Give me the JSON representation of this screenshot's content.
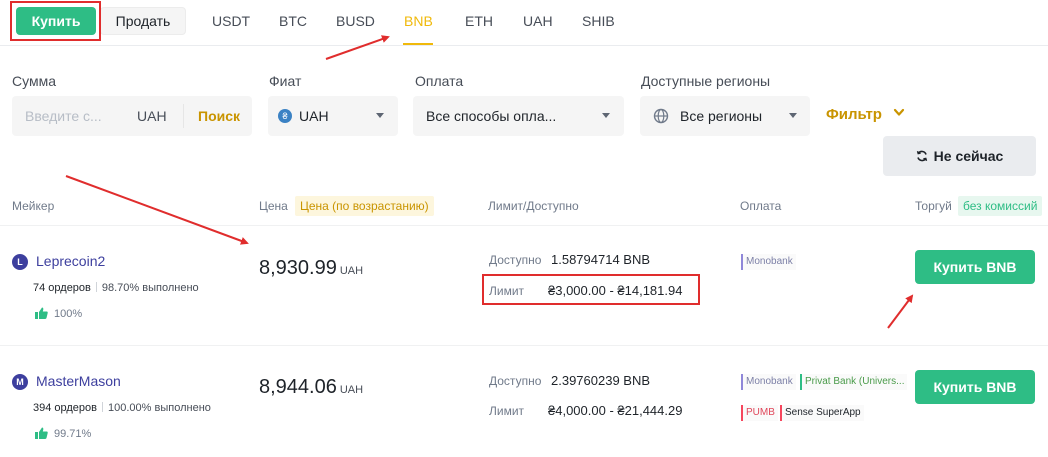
{
  "trade_toggle": {
    "buy": "Купить",
    "sell": "Продать"
  },
  "coins": [
    "USDT",
    "BTC",
    "BUSD",
    "BNB",
    "ETH",
    "UAH",
    "SHIB"
  ],
  "active_coin": "BNB",
  "filters": {
    "amount_label": "Сумма",
    "amount_placeholder": "Введите с...",
    "amount_currency": "UAH",
    "search": "Поиск",
    "fiat_label": "Фиат",
    "fiat_value": "UAH",
    "payment_label": "Оплата",
    "payment_value": "Все способы опла...",
    "regions_label": "Доступные регионы",
    "regions_value": "Все регионы",
    "filter": "Фильтр",
    "not_now": "Не сейчас"
  },
  "table_header": {
    "maker": "Мейкер",
    "price": "Цена",
    "price_badge": "Цена (по возрастанию)",
    "limit": "Лимит/Доступно",
    "payment": "Оплата",
    "trade": "Торгуй",
    "trade_badge": "без комиссий"
  },
  "rows": [
    {
      "avatar": "L",
      "maker": "Leprecoin2",
      "orders": "74 ордеров",
      "completion": "98.70% выполнено",
      "rating": "100%",
      "price": "8,930.99",
      "currency": "UAH",
      "available_label": "Доступно",
      "available": "1.58794714 BNB",
      "limit_label": "Лимит",
      "limit": "₴3,000.00 - ₴14,181.94",
      "payments": [
        "Monobank"
      ],
      "button": "Купить BNB"
    },
    {
      "avatar": "M",
      "maker": "MasterMason",
      "orders": "394 ордеров",
      "completion": "100.00% выполнено",
      "rating": "99.71%",
      "price": "8,944.06",
      "currency": "UAH",
      "available_label": "Доступно",
      "available": "2.39760239 BNB",
      "limit_label": "Лимит",
      "limit": "₴4,000.00 - ₴21,444.29",
      "payments": [
        "Monobank",
        "Privat Bank (Univers...",
        "PUMB",
        "Sense SuperApp"
      ],
      "button": "Купить BNB"
    }
  ],
  "colors": {
    "accent": "#f0b90b",
    "buy": "#2ebd85",
    "annotation": "#e02d2d"
  }
}
